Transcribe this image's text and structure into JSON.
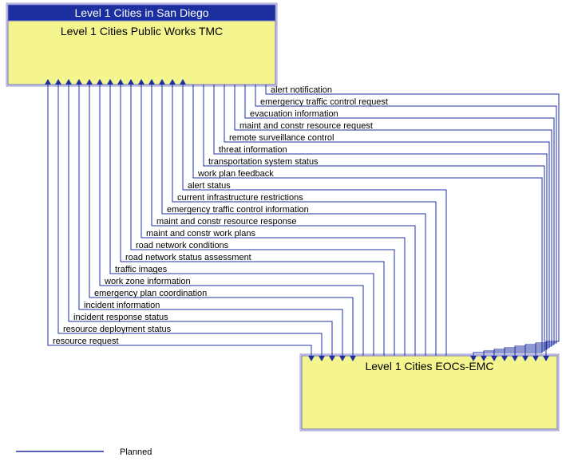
{
  "top_box": {
    "header": "Level 1 Cities in San Diego",
    "title": "Level 1 Cities Public Works TMC"
  },
  "bottom_box": {
    "title": "Level 1 Cities EOCs-EMC"
  },
  "flows": {
    "to_bottom": [
      "alert notification",
      "emergency traffic control request",
      "evacuation information",
      "maint and constr resource request",
      "remote surveillance control",
      "threat information",
      "transportation system status",
      "work plan feedback"
    ],
    "to_top": [
      "alert status",
      "current infrastructure restrictions",
      "emergency traffic control information",
      "maint and constr resource response",
      "maint and constr work plans",
      "road network conditions",
      "road network status assessment",
      "traffic images",
      "work zone information"
    ],
    "both": [
      "emergency plan coordination",
      "incident information",
      "incident response status",
      "resource deployment status",
      "resource request"
    ]
  },
  "legend": {
    "planned": "Planned"
  },
  "colors": {
    "box_fill": "#f4f58f",
    "header_fill": "#1c2f9f",
    "line": "#1c2f9f",
    "border": "#6c6cd0"
  }
}
